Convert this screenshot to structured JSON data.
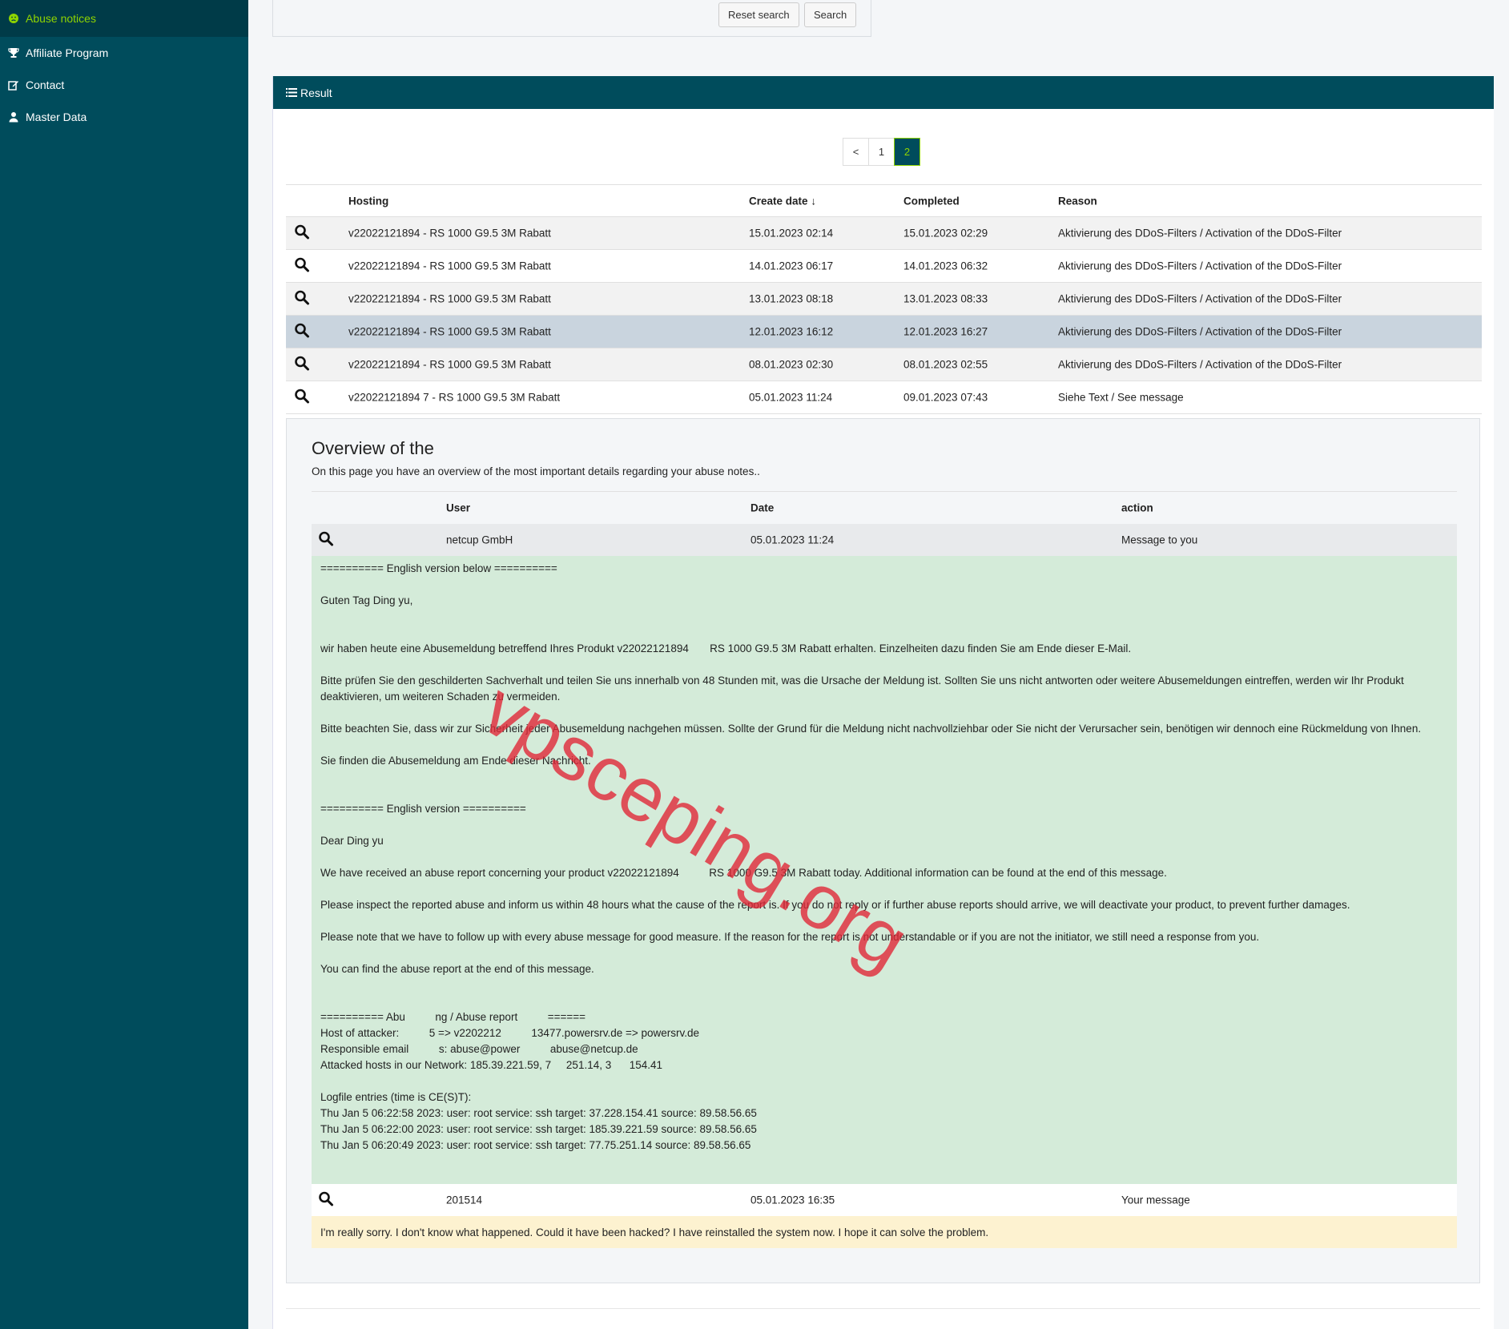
{
  "sidebar": {
    "items": [
      {
        "label": "Abuse notices",
        "icon": "frown-icon",
        "active": true
      },
      {
        "label": "Affiliate Program",
        "icon": "trophy-icon"
      },
      {
        "label": "Contact",
        "icon": "edit-icon"
      },
      {
        "label": "Master Data",
        "icon": "user-icon"
      }
    ]
  },
  "search": {
    "reset_label": "Reset search",
    "search_label": "Search"
  },
  "result": {
    "title": "Result",
    "pagination": [
      "<",
      "1",
      "2"
    ],
    "current_page": "2",
    "columns": [
      "Hosting",
      "Create date",
      "Completed",
      "Reason"
    ],
    "rows": [
      {
        "hosting": "v22022121894   - RS 1000 G9.5 3M Rabatt",
        "create": "15.01.2023 02:14",
        "completed": "15.01.2023 02:29",
        "reason": "Aktivierung des DDoS-Filters / Activation of the DDoS-Filter"
      },
      {
        "hosting": "v22022121894   - RS 1000 G9.5 3M Rabatt",
        "create": "14.01.2023 06:17",
        "completed": "14.01.2023 06:32",
        "reason": "Aktivierung des DDoS-Filters / Activation of the DDoS-Filter"
      },
      {
        "hosting": "v22022121894   - RS 1000 G9.5 3M Rabatt",
        "create": "13.01.2023 08:18",
        "completed": "13.01.2023 08:33",
        "reason": "Aktivierung des DDoS-Filters / Activation of the DDoS-Filter"
      },
      {
        "hosting": "v22022121894   - RS 1000 G9.5 3M Rabatt",
        "create": "12.01.2023 16:12",
        "completed": "12.01.2023 16:27",
        "reason": "Aktivierung des DDoS-Filters / Activation of the DDoS-Filter"
      },
      {
        "hosting": "v22022121894   - RS 1000 G9.5 3M Rabatt",
        "create": "08.01.2023 02:30",
        "completed": "08.01.2023 02:55",
        "reason": "Aktivierung des DDoS-Filters / Activation of the DDoS-Filter"
      },
      {
        "hosting": "v22022121894   7 - RS 1000 G9.5 3M Rabatt",
        "create": "05.01.2023 11:24",
        "completed": "09.01.2023 07:43",
        "reason": "Siehe Text / See message"
      }
    ]
  },
  "overview": {
    "title": "Overview of the",
    "subtitle": "On this page you have an overview of the most important details regarding your abuse notes..",
    "columns": [
      "User",
      "Date",
      "action"
    ],
    "entry1": {
      "user": "netcup GmbH",
      "date": "05.01.2023 11:24",
      "action": "Message to you"
    },
    "message1": [
      "========== English version below ==========",
      "Guten Tag Ding yu,",
      "",
      "wir haben heute eine Abusemeldung betreffend Ihres Produkt v22022121894       RS 1000 G9.5 3M Rabatt erhalten. Einzelheiten dazu finden Sie am Ende dieser E-Mail.",
      "Bitte prüfen Sie den geschilderten Sachverhalt und teilen Sie uns innerhalb von 48 Stunden mit, was die Ursache der Meldung ist. Sollten Sie uns nicht antworten oder weitere Abusemeldungen eintreffen, werden wir Ihr Produkt deaktivieren, um weiteren Schaden zu vermeiden.",
      "Bitte beachten Sie, dass wir zur Sicherheit jeder Abusemeldung nachgehen müssen. Sollte der Grund für die Meldung nicht nachvollziehbar oder Sie nicht der Verursacher sein, benötigen wir dennoch eine Rückmeldung von Ihnen.",
      "Sie finden die Abusemeldung am Ende dieser Nachricht.",
      "",
      "========== English version ==========",
      "Dear Ding yu",
      "We have received an abuse report concerning your product v22022121894          RS 1000 G9.5 3M Rabatt today. Additional information can be found at the end of this message.",
      "Please inspect the reported abuse and inform us within 48 hours what the cause of the report is. If you do not reply or if further abuse reports should arrive, we will deactivate your product, to prevent further damages.",
      "Please note that we have to follow up with every abuse message for good measure. If the reason for the report is not understandable or if you are not the initiator, we still need a response from you.",
      "You can find the abuse report at the end of this message.",
      "",
      "========== Abu          ng / Abuse report          ======\nHost of attacker:          5 => v2202212          13477.powersrv.de => powersrv.de\nResponsible email          s: abuse@power          abuse@netcup.de\nAttacked hosts in our Network: 185.39.221.59, 7     251.14, 3      154.41",
      "Logfile entries (time is CE(S)T):\nThu Jan 5 06:22:58 2023: user: root service: ssh target: 37.228.154.41 source: 89.58.56.65\nThu Jan 5 06:22:00 2023: user: root service: ssh target: 185.39.221.59 source: 89.58.56.65\nThu Jan 5 06:20:49 2023: user: root service: ssh target: 77.75.251.14 source: 89.58.56.65"
    ],
    "entry2": {
      "user": "201514",
      "date": "05.01.2023 16:35",
      "action": "Your message"
    },
    "message2": "I'm really sorry. I don't know what happened. Could it have been hacked? I have reinstalled the system now. I hope it can solve the problem."
  },
  "watermark": "vpsceping.org",
  "colors": {
    "sidebar": "#004c5c",
    "accent": "#8fd400",
    "green_msg": "#d4ebd9",
    "yellow_msg": "#fdf2d0"
  }
}
